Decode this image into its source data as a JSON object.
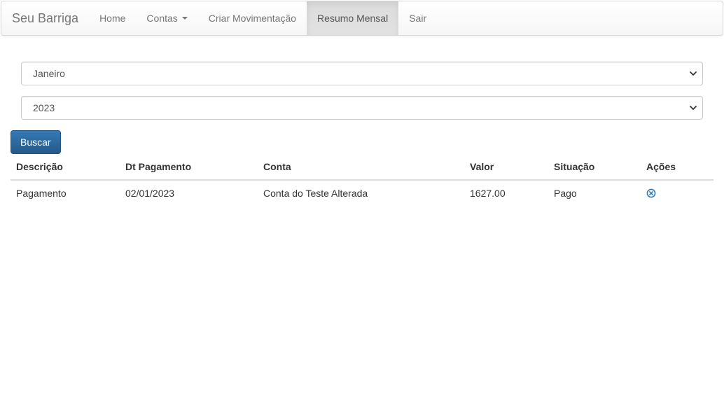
{
  "navbar": {
    "brand": "Seu Barriga",
    "items": [
      {
        "label": "Home"
      },
      {
        "label": "Contas"
      },
      {
        "label": "Criar Movimentação"
      },
      {
        "label": "Resumo Mensal"
      },
      {
        "label": "Sair"
      }
    ]
  },
  "filters": {
    "month": {
      "selected": "Janeiro"
    },
    "year": {
      "selected": "2023"
    },
    "search_button": "Buscar"
  },
  "table": {
    "headers": [
      "Descrição",
      "Dt Pagamento",
      "Conta",
      "Valor",
      "Situação",
      "Ações"
    ],
    "rows": [
      {
        "descricao": "Pagamento",
        "dt_pagamento": "02/01/2023",
        "conta": "Conta do Teste Alterada",
        "valor": "1627.00",
        "situacao": "Pago",
        "acao_icon": "remove-circle-icon"
      }
    ]
  },
  "colors": {
    "primary": "#337ab7",
    "nav_text": "#777777",
    "active_nav_bg": "#e0e0e0"
  }
}
